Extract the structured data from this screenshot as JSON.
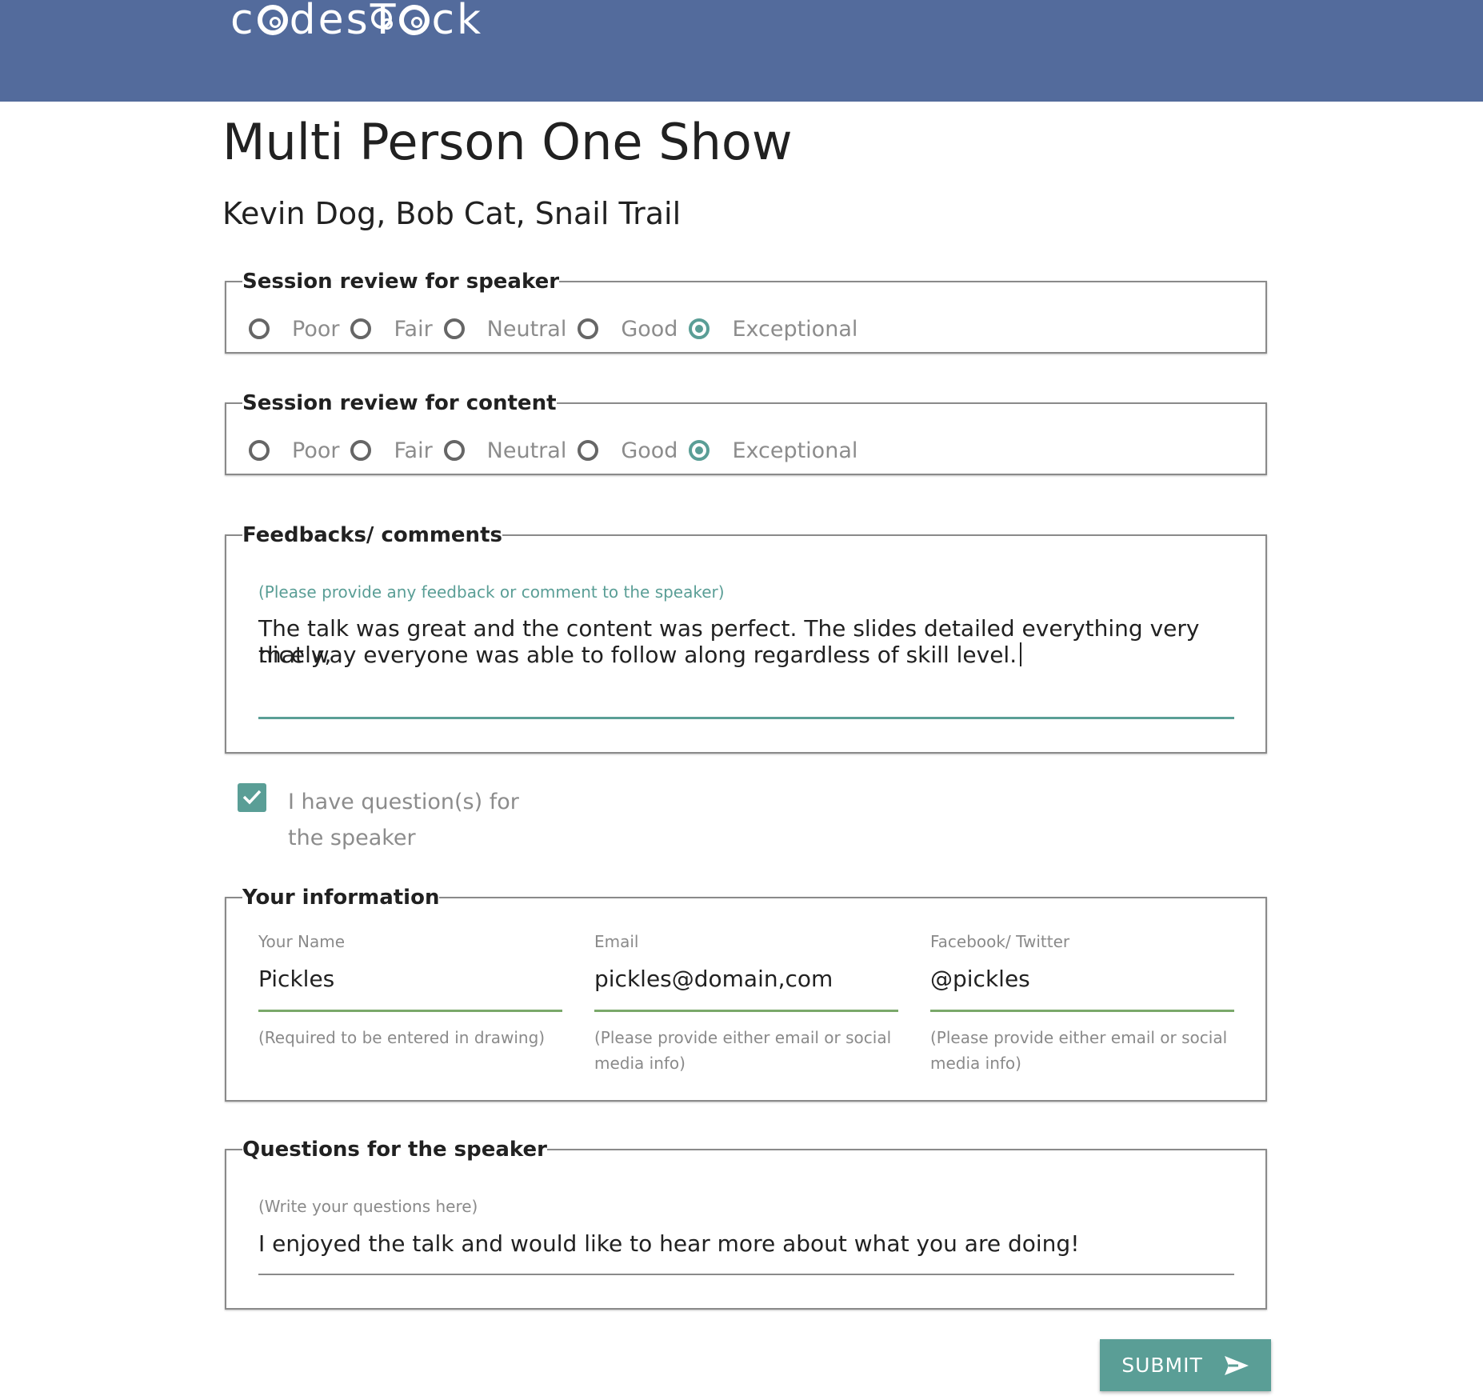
{
  "header": {
    "logo_text": "codestock"
  },
  "session": {
    "title": "Multi Person One Show",
    "speakers": "Kevin Dog, Bob Cat, Snail Trail"
  },
  "speaker_review": {
    "legend": "Session review for speaker",
    "options": [
      "Poor",
      "Fair",
      "Neutral",
      "Good",
      "Exceptional"
    ],
    "selected": "Exceptional"
  },
  "content_review": {
    "legend": "Session review for content",
    "options": [
      "Poor",
      "Fair",
      "Neutral",
      "Good",
      "Exceptional"
    ],
    "selected": "Exceptional"
  },
  "feedback": {
    "legend": "Feedbacks/ comments",
    "hint": "(Please provide any feedback or comment to the speaker)",
    "line1": "The talk was great and the content was perfect. The slides detailed everything very nicely,",
    "line2": "that way everyone was able to follow along regardless of skill level."
  },
  "questions_checkbox": {
    "checked": true,
    "label": "I have question(s) for the speaker"
  },
  "your_info": {
    "legend": "Your information",
    "name": {
      "label": "Your Name",
      "value": "Pickles",
      "help": "(Required to be entered in drawing)"
    },
    "email": {
      "label": "Email",
      "value": "pickles@domain,com",
      "help": "(Please provide either email or social media info)"
    },
    "social": {
      "label": "Facebook/ Twitter",
      "value": "@pickles",
      "help": "(Please provide either email or social media info)"
    }
  },
  "questions": {
    "legend": "Questions for the speaker",
    "hint": "(Write your questions here)",
    "value": "I enjoyed the talk and would like to hear more about what you are doing!"
  },
  "submit": {
    "label": "SUBMIT"
  },
  "colors": {
    "header": "#536b9c",
    "accent": "#5a9e96",
    "underline_green": "#7aa86a"
  }
}
